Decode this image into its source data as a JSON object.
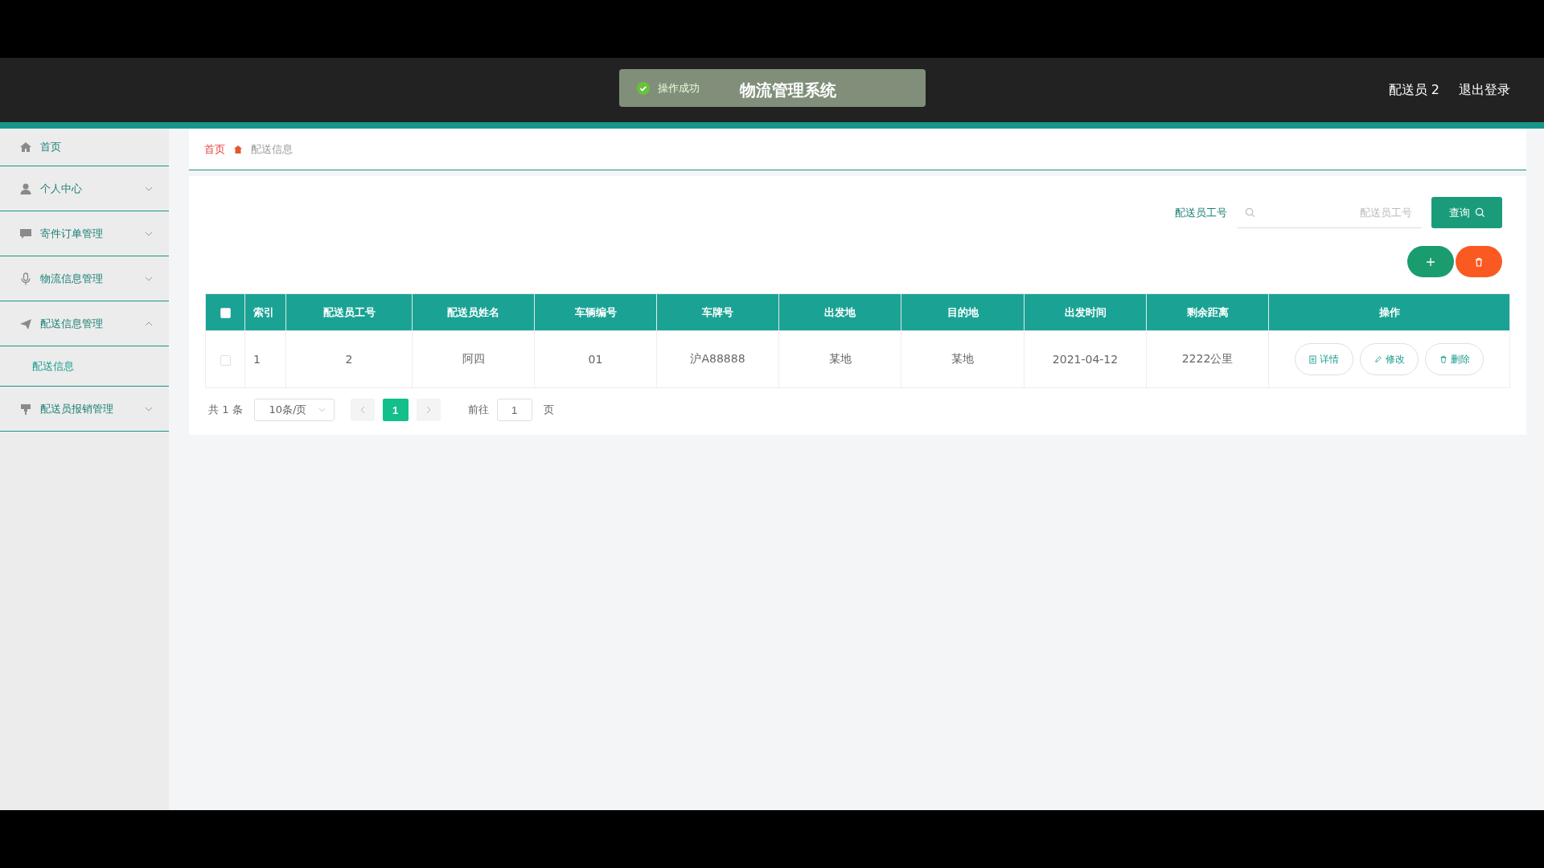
{
  "header": {
    "title": "物流管理系统",
    "user": "配送员 2",
    "logout": "退出登录"
  },
  "toast": {
    "kind": "success",
    "message": "操作成功"
  },
  "sidebar": {
    "items": [
      {
        "label": "首页"
      },
      {
        "label": "个人中心",
        "expanded": false
      },
      {
        "label": "寄件订单管理",
        "expanded": false
      },
      {
        "label": "物流信息管理",
        "expanded": false
      },
      {
        "label": "配送信息管理",
        "expanded": true,
        "children": [
          {
            "label": "配送信息",
            "selected": true
          }
        ]
      },
      {
        "label": "配送员报销管理",
        "expanded": false
      }
    ]
  },
  "breadcrumb": [
    {
      "label": "首页"
    },
    {
      "label": "配送信息"
    }
  ],
  "search": {
    "label": "配送员工号",
    "placeholder": "配送员工号",
    "button": "查询"
  },
  "table": {
    "header_checked": false,
    "columns": [
      "索引",
      "配送员工号",
      "配送员姓名",
      "车辆编号",
      "车牌号",
      "出发地",
      "目的地",
      "出发时间",
      "剩余距离",
      "操作"
    ],
    "rows": [
      {
        "checked": false,
        "cells": [
          "1",
          "2",
          "阿四",
          "01",
          "沪A88888",
          "某地",
          "某地",
          "2021-04-12",
          "2222公里"
        ],
        "actions": [
          {
            "kind": "detail",
            "label": "详情"
          },
          {
            "kind": "edit",
            "label": "修改"
          },
          {
            "kind": "delete",
            "label": "删除"
          }
        ]
      }
    ]
  },
  "pagination": {
    "total": "共 1 条",
    "page_size": "10条/页",
    "pages": [
      {
        "label": "1",
        "selected": true
      }
    ],
    "goto_prefix": "前往",
    "goto_value": "1",
    "goto_suffix": "页"
  }
}
